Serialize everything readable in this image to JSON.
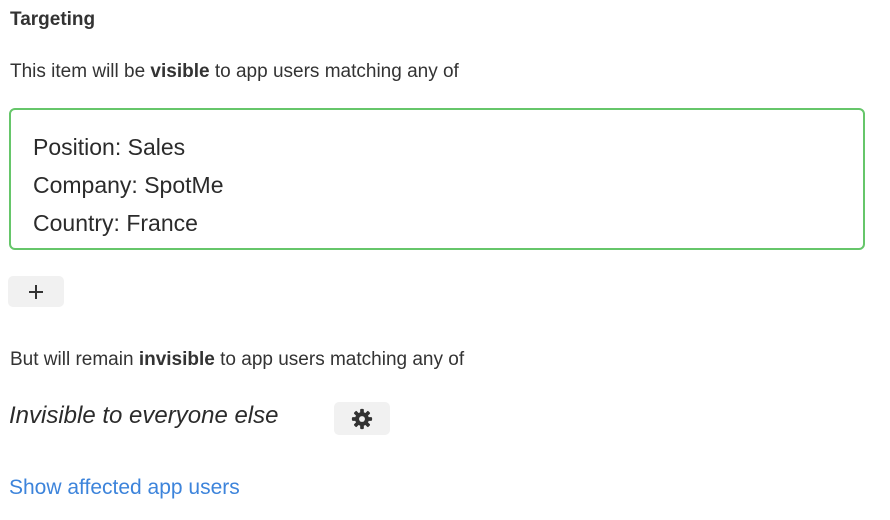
{
  "targeting": {
    "heading": "Targeting",
    "visible": {
      "prefix": "This item will be ",
      "keyword": "visible",
      "suffix": " to app users matching any of",
      "rules": [
        "Position: Sales",
        "Company: SpotMe",
        "Country: France"
      ],
      "add_button_icon": "plus-icon",
      "border_color": "#66c66a"
    },
    "invisible": {
      "prefix": "But will remain ",
      "keyword": "invisible",
      "suffix": " to app users matching any of",
      "fallback_text": "Invisible to everyone else",
      "settings_button_icon": "gear-icon"
    },
    "link_label": "Show affected app users",
    "link_color": "#3d84db"
  }
}
